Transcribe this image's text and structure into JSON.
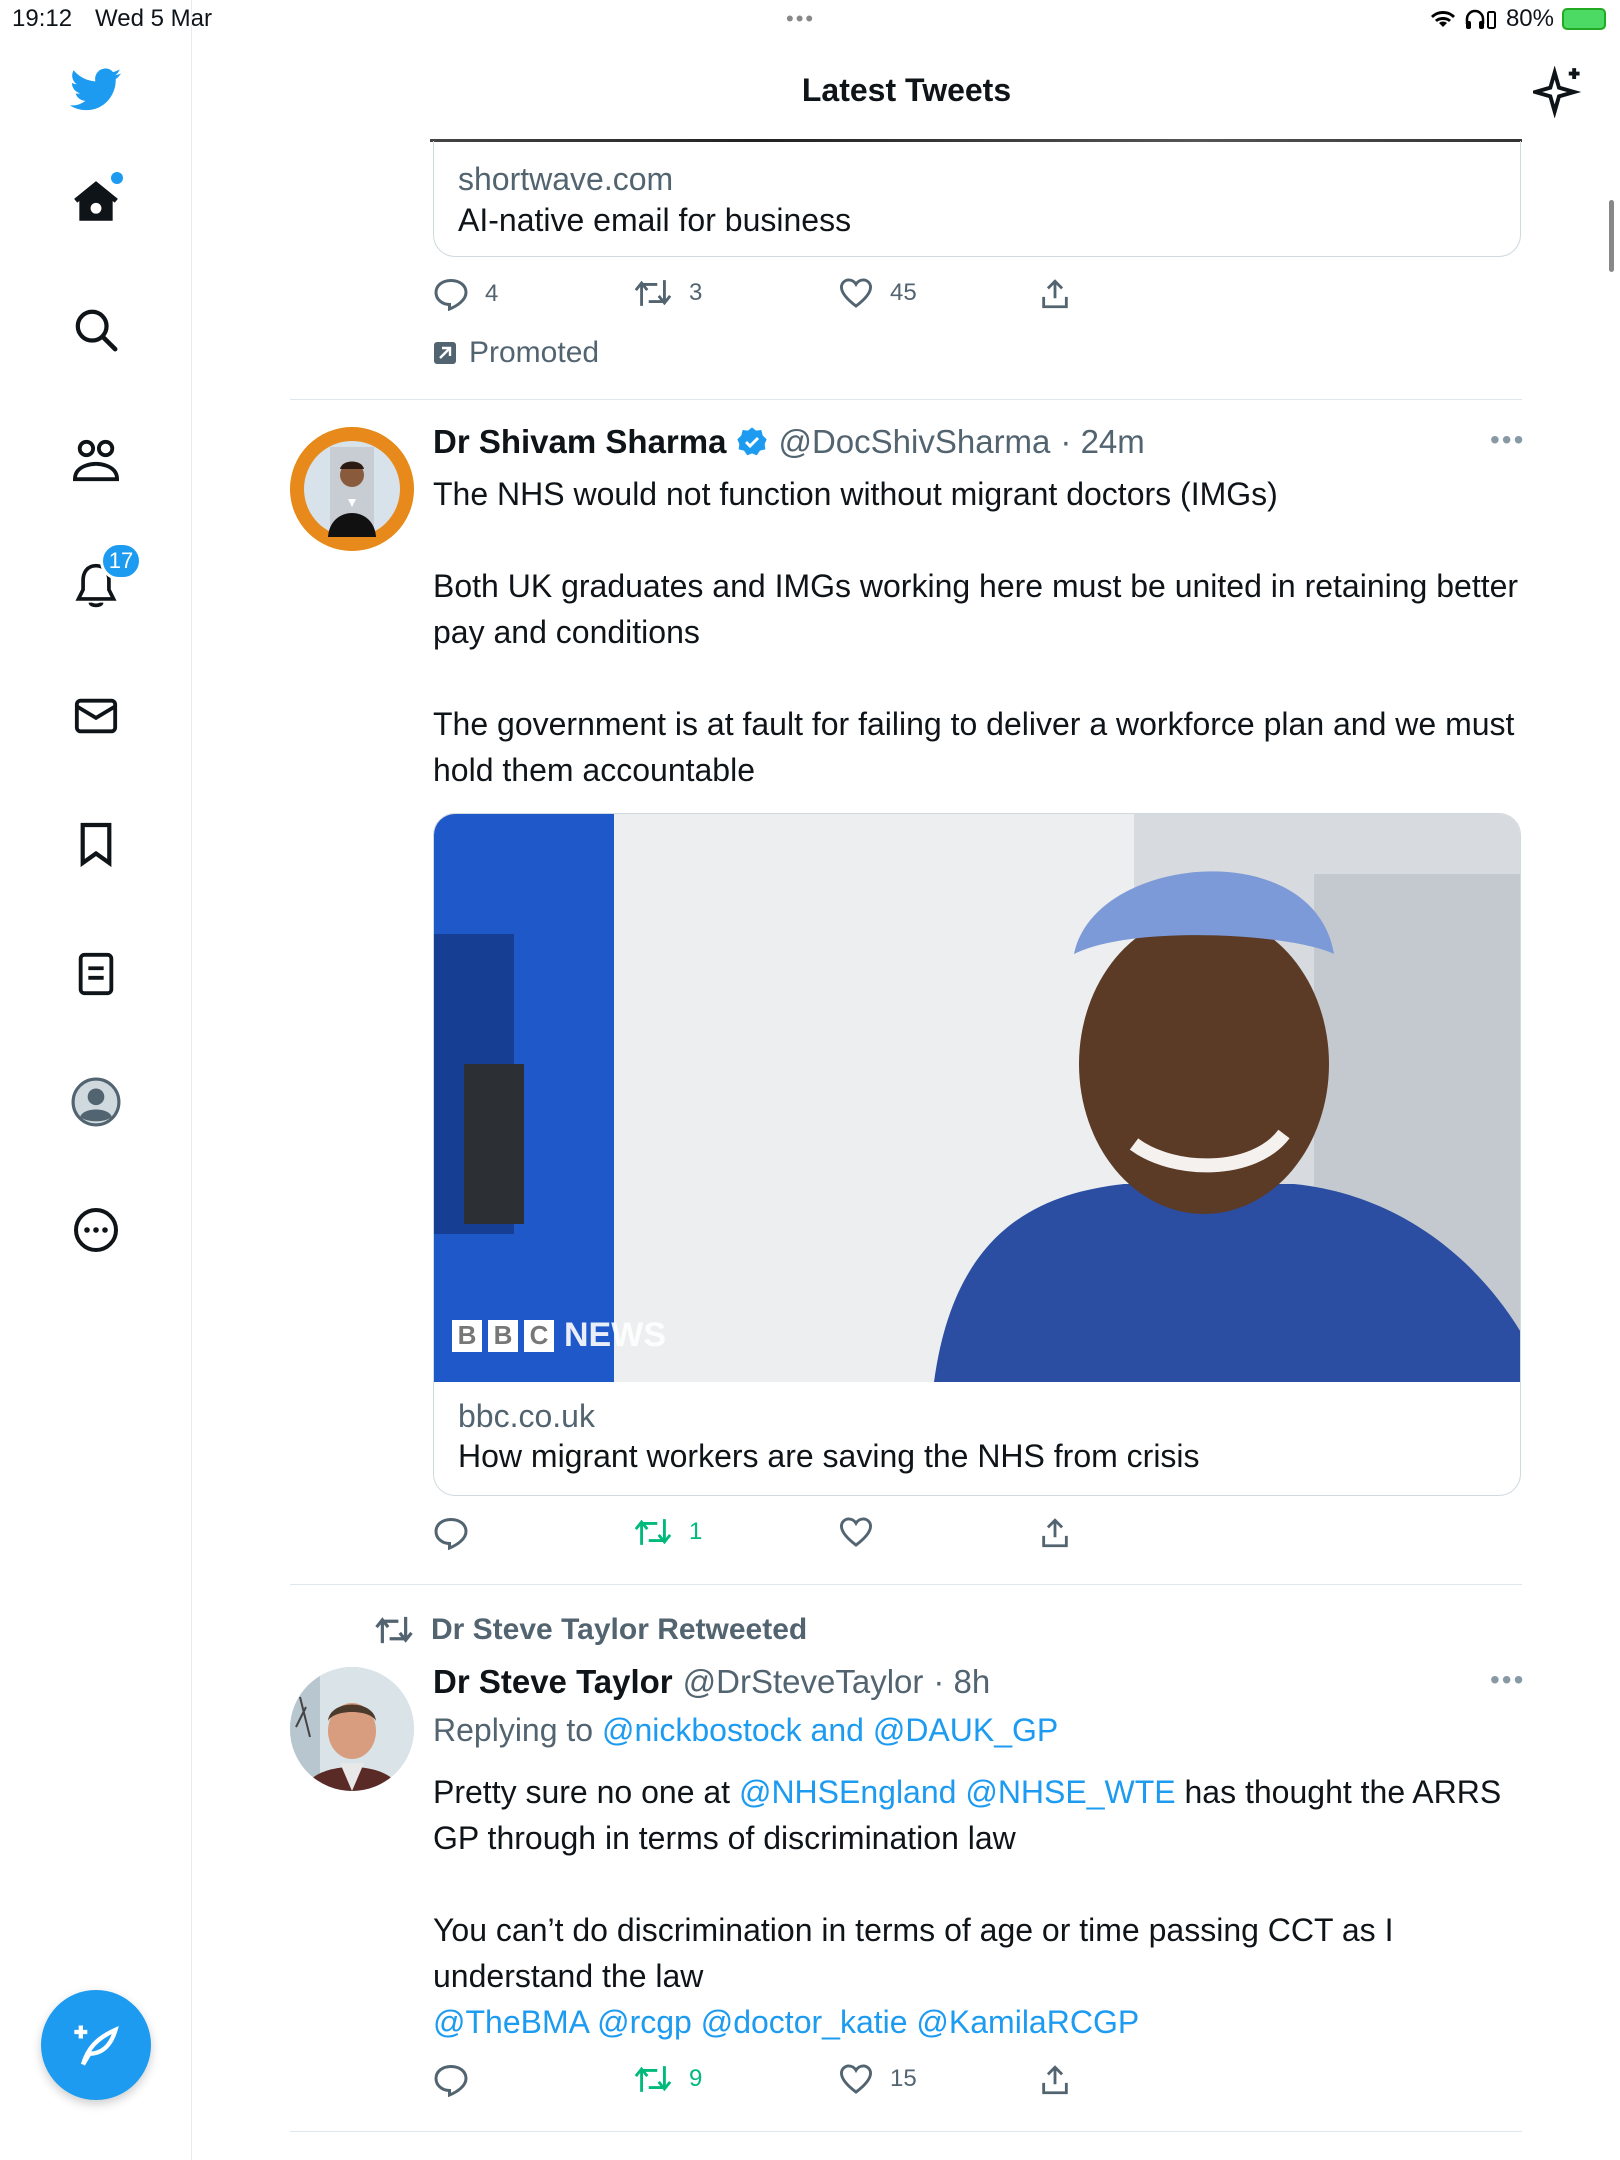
{
  "status_bar": {
    "time": "19:12",
    "date": "Wed 5 Mar",
    "battery": "80%"
  },
  "header": {
    "title": "Latest Tweets"
  },
  "sidebar": {
    "notification_badge": "17"
  },
  "promo_tweet": {
    "card_domain": "shortwave.com",
    "card_title": "AI-native email for business",
    "replies": "4",
    "retweets": "3",
    "likes": "45",
    "promoted_label": "Promoted"
  },
  "tweet1": {
    "name": "Dr Shivam Sharma",
    "handle": "@DocShivSharma",
    "time": "· 24m",
    "text": "The NHS would not function without migrant doctors (IMGs)\n\nBoth UK graduates and IMGs working here must be united in retaining better pay and conditions\n\nThe government is at fault for failing to deliver a workforce plan and we must hold them accountable",
    "image_watermark": "NEWS",
    "image_logo_letters": [
      "B",
      "B",
      "C"
    ],
    "card_domain": "bbc.co.uk",
    "card_title": "How migrant workers are saving the NHS from crisis",
    "retweets": "1"
  },
  "tweet2": {
    "retweeted_by": "Dr Steve Taylor Retweeted",
    "name": "Dr Steve Taylor",
    "handle": "@DrSteveTaylor",
    "time": "· 8h",
    "replying_label": "Replying to",
    "replying_users": "@nickbostock and @DAUK_GP",
    "text_part1": "Pretty sure no one at ",
    "mention1": "@NHSEngland @NHSE_WTE",
    "text_part2": " has thought the ARRS GP through in terms of discrimination law\n\nYou can’t do discrimination in terms of age or time passing CCT as I understand the law",
    "mentions_line": "@TheBMA @rcgp @doctor_katie @KamilaRCGP",
    "retweets": "9",
    "likes": "15"
  },
  "colors": {
    "accent": "#1d9bf0",
    "retweet_green": "#00ba7c",
    "muted": "#536471"
  }
}
